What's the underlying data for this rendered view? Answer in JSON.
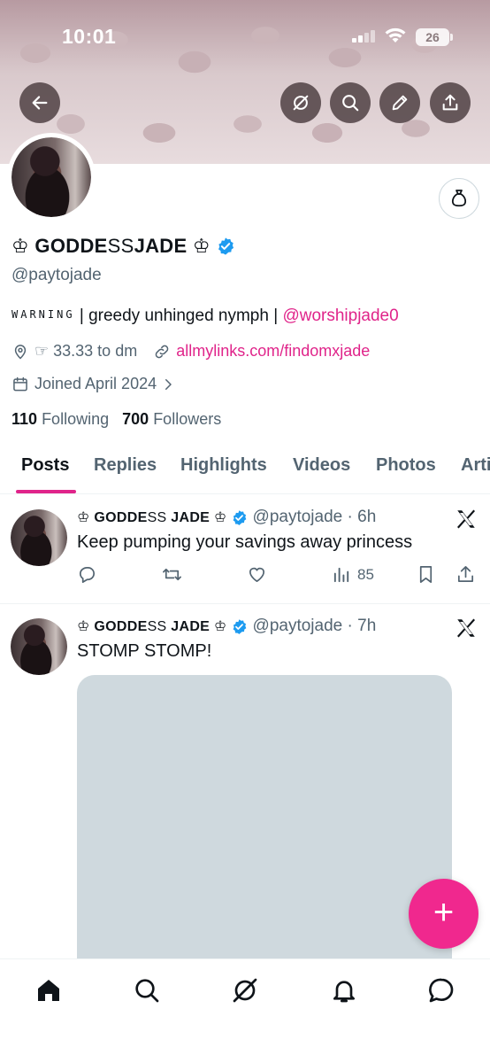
{
  "status_bar": {
    "time": "10:01",
    "battery": "26"
  },
  "profile": {
    "name_prefix": "♔ GODDE",
    "name_mid": "SS",
    "name_suffix": " JADE ♔",
    "handle": "@paytojade",
    "bio_warning": "WARNING",
    "bio_text": " | greedy unhinged nymph | ",
    "bio_mention": "@worshipjade0",
    "location": "☞ 33.33 to dm",
    "link": "allmylinks.com/findomxjade",
    "joined": "Joined April 2024",
    "following_count": "110",
    "following_label": "Following",
    "followers_count": "700",
    "followers_label": "Followers"
  },
  "tabs": [
    "Posts",
    "Replies",
    "Highlights",
    "Videos",
    "Photos",
    "Articles"
  ],
  "posts": [
    {
      "name_prefix": "♔ GODDE",
      "name_mid": "SS",
      "name_suffix": " JADE ♔",
      "handle": "@paytojade",
      "time": "6h",
      "text": "Keep pumping your savings away princess",
      "views": "85"
    },
    {
      "name_prefix": "♔ GODDE",
      "name_mid": "SS",
      "name_suffix": " JADE ♔",
      "handle": "@paytojade",
      "time": "7h",
      "text": "STOMP STOMP!"
    }
  ],
  "fab": {
    "label": "+"
  },
  "icons": {
    "back": "back-arrow-icon",
    "grok": "grok-icon",
    "search": "search-icon",
    "edit": "pencil-icon",
    "share": "share-icon",
    "moneybag": "money-bag-icon",
    "verified": "verified-badge-icon",
    "x": "x-logo-icon"
  },
  "colors": {
    "accent": "#e0248a",
    "fab": "#f0288e",
    "verified": "#1d9bf0",
    "secondary_text": "#536471"
  }
}
